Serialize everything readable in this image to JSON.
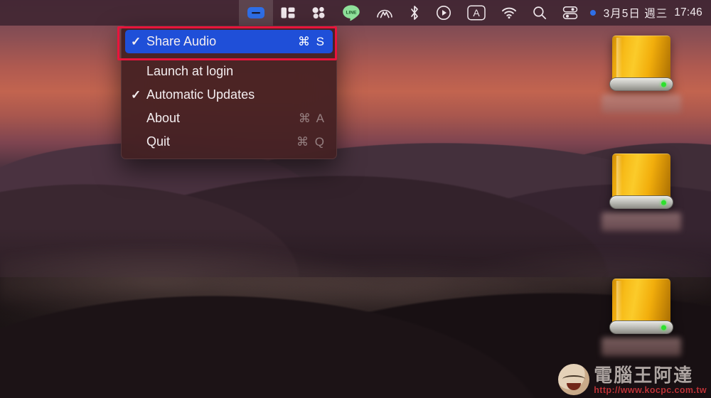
{
  "menubar": {
    "extras": [
      {
        "name": "airpods-case-icon",
        "label": "Share Audio menu extra",
        "active": true
      },
      {
        "name": "split-view-icon",
        "label": "Split View",
        "active": false
      },
      {
        "name": "cleanmymac-flower-icon",
        "label": "CleanMyMac",
        "active": false
      },
      {
        "name": "line-icon",
        "label": "LINE",
        "active": false
      },
      {
        "name": "nordvpn-icon",
        "label": "NordVPN",
        "active": false
      },
      {
        "name": "bluetooth-icon",
        "label": "Bluetooth",
        "active": false
      },
      {
        "name": "play-circle-icon",
        "label": "Media Player",
        "active": false
      },
      {
        "name": "input-source-icon",
        "label": "A",
        "active": false
      },
      {
        "name": "wifi-icon",
        "label": "Wi-Fi",
        "active": false
      },
      {
        "name": "spotlight-search-icon",
        "label": "Spotlight Search",
        "active": false
      },
      {
        "name": "control-center-icon",
        "label": "Control Center",
        "active": false
      }
    ],
    "input_source_letter": "A",
    "line_text": "LINE",
    "clock": {
      "date": "3月5日 週三",
      "time": "17:46"
    }
  },
  "menu": {
    "items": [
      {
        "tick": "✓",
        "label": "Share Audio",
        "shortcut": "⌘ S",
        "selected": true
      },
      {
        "tick": "",
        "label": "Launch at login",
        "shortcut": "",
        "selected": false
      },
      {
        "tick": "✓",
        "label": "Automatic Updates",
        "shortcut": "",
        "selected": false
      },
      {
        "tick": "",
        "label": "About",
        "shortcut": "⌘ A",
        "selected": false
      },
      {
        "tick": "",
        "label": "Quit",
        "shortcut": "⌘ Q",
        "selected": false
      }
    ]
  },
  "desktop": {
    "drives": [
      {
        "name": "external-drive-1",
        "label": ""
      },
      {
        "name": "external-drive-2",
        "label": ""
      },
      {
        "name": "external-drive-3",
        "label": ""
      }
    ]
  },
  "watermark": {
    "title": "電腦王阿達",
    "url": "http://www.kocpc.com.tw"
  },
  "colors": {
    "highlight_blue": "#1f4fd8",
    "annotation_red": "#e8143c",
    "menubar_bg": "#3e2430",
    "menu_bg": "#422022",
    "drive_orange": "#f7bb18",
    "drive_led_green": "#2ee02e",
    "status_dot_blue": "#2f6fe8"
  }
}
